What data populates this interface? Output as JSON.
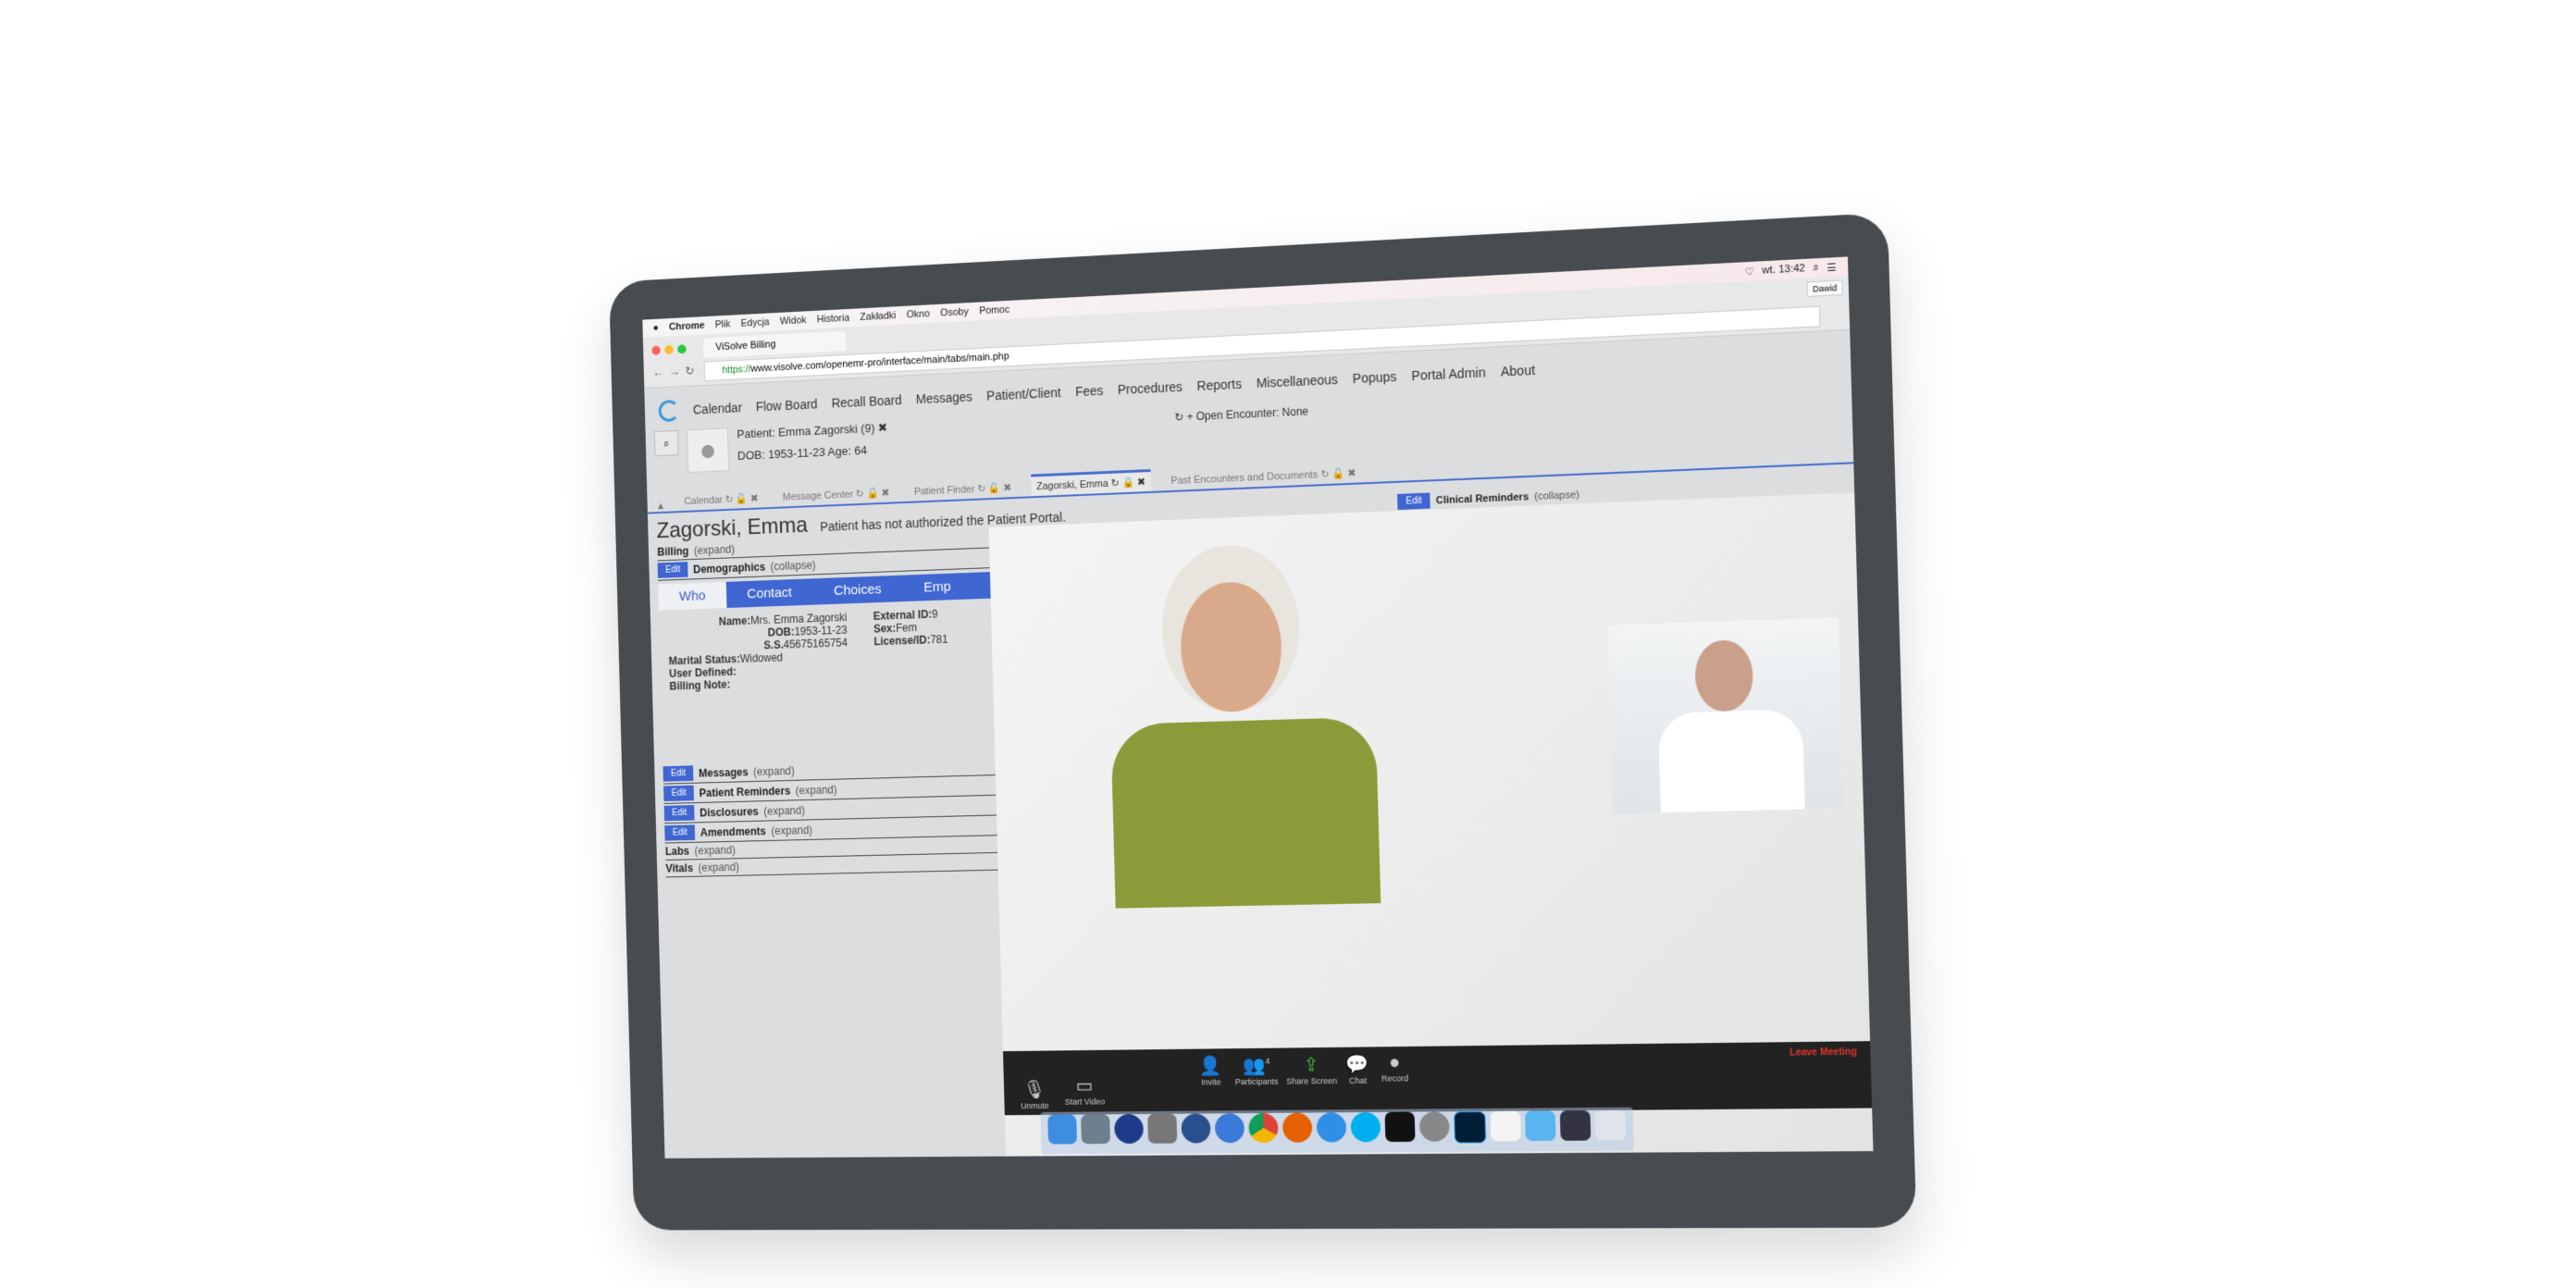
{
  "mac_menu": {
    "app": "Chrome",
    "items": [
      "Plik",
      "Edycja",
      "Widok",
      "Historia",
      "Zakładki",
      "Okno",
      "Osoby",
      "Pomoc"
    ],
    "clock": "wt. 13:42"
  },
  "browser": {
    "tab_title": "ViSolve Billing",
    "url_scheme": "https://",
    "url_rest": "www.visolve.com/openemr-pro/interface/main/tabs/main.php",
    "user_button": "Dawid"
  },
  "nav": {
    "items": [
      "Calendar",
      "Flow Board",
      "Recall Board",
      "Messages",
      "Patient/Client",
      "Fees",
      "Procedures",
      "Reports",
      "Miscellaneous",
      "Popups",
      "Portal Admin",
      "About"
    ]
  },
  "patient": {
    "line1": "Patient: Emma Zagorski (9)",
    "line2": "DOB: 1953-11-23 Age: 64",
    "encounter": "Open Encounter: None"
  },
  "tabs": [
    "Calendar",
    "Message Center",
    "Patient Finder",
    "Zagorski, Emma",
    "Past Encounters and Documents"
  ],
  "page": {
    "title": "Zagorski, Emma",
    "notice": "Patient has not authorized the Patient Portal.",
    "edit_label": "Edit",
    "billing": {
      "label": "Billing",
      "toggle": "(expand)"
    },
    "demographics": {
      "label": "Demographics",
      "toggle": "(collapse)"
    },
    "demo_tabs": [
      "Who",
      "Contact",
      "Choices",
      "Emp"
    ],
    "fields": [
      [
        "Name:",
        "Mrs. Emma  Zagorski"
      ],
      [
        "DOB:",
        "1953-11-23"
      ],
      [
        "S.S.",
        "45675165754"
      ],
      [
        "Marital Status:",
        "Widowed"
      ],
      [
        "User Defined:",
        ""
      ],
      [
        "Billing Note:",
        ""
      ]
    ],
    "fields2": [
      [
        "External ID:",
        "9"
      ],
      [
        "Sex:",
        "Fem"
      ],
      [
        "License/ID:",
        "781"
      ]
    ],
    "sections": [
      {
        "label": "Messages",
        "toggle": "(expand)",
        "edit": true
      },
      {
        "label": "Patient Reminders",
        "toggle": "(expand)",
        "edit": true
      },
      {
        "label": "Disclosures",
        "toggle": "(expand)",
        "edit": true
      },
      {
        "label": "Amendments",
        "toggle": "(expand)",
        "edit": true
      },
      {
        "label": "Labs",
        "toggle": "(expand)",
        "edit": false
      },
      {
        "label": "Vitals",
        "toggle": "(expand)",
        "edit": false
      }
    ],
    "clinical": {
      "label": "Clinical Reminders",
      "toggle": "(collapse)"
    }
  },
  "zoom": {
    "unmute": "Unmute",
    "start_video": "Start Video",
    "invite": "Invite",
    "participants": "Participants",
    "participant_count": "4",
    "share": "Share Screen",
    "chat": "Chat",
    "record": "Record",
    "leave": "Leave Meeting"
  },
  "colors": {
    "accent": "#3f66d1",
    "leave": "#e0352c",
    "frame": "#474c51"
  }
}
